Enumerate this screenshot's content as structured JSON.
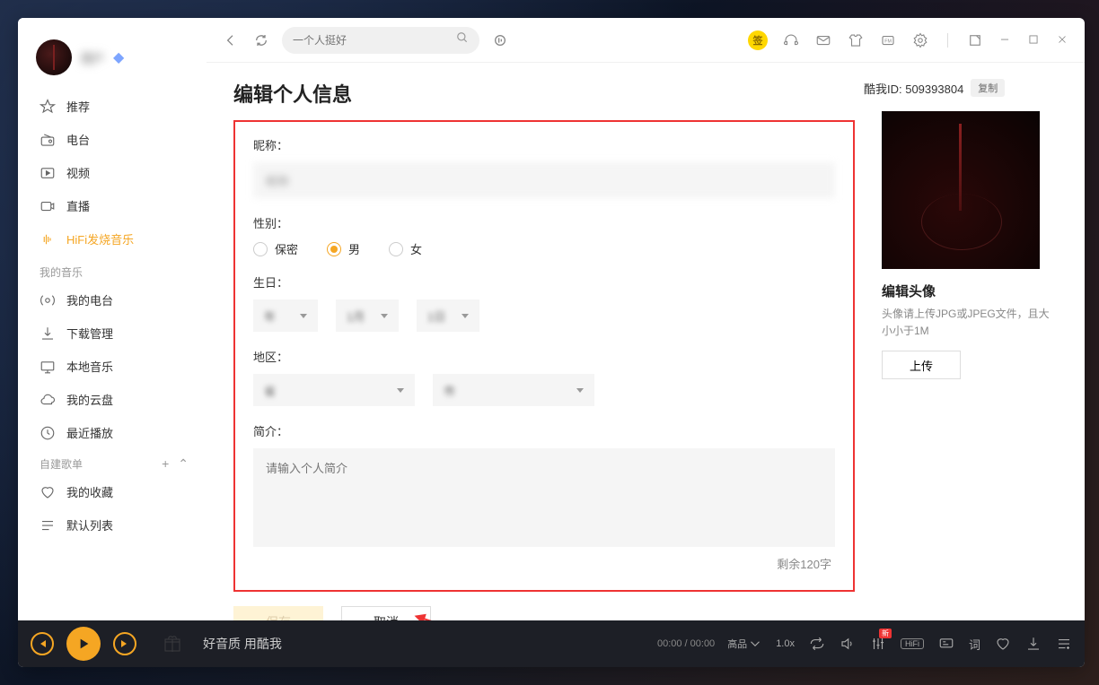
{
  "sidebar": {
    "username_blur": "用户",
    "items": [
      {
        "label": "推荐"
      },
      {
        "label": "电台"
      },
      {
        "label": "视频"
      },
      {
        "label": "直播"
      },
      {
        "label": "HiFi发烧音乐"
      }
    ],
    "section_my": "我的音乐",
    "my_items": [
      {
        "label": "我的电台"
      },
      {
        "label": "下载管理"
      },
      {
        "label": "本地音乐"
      },
      {
        "label": "我的云盘"
      },
      {
        "label": "最近播放"
      }
    ],
    "section_lists": "自建歌单",
    "list_items": [
      {
        "label": "我的收藏"
      },
      {
        "label": "默认列表"
      }
    ]
  },
  "topbar": {
    "search_placeholder": "一个人挺好",
    "sign_char": "签"
  },
  "page": {
    "title": "编辑个人信息",
    "nick_label": "昵称：",
    "nick_blur": "昵称",
    "gender_label": "性别：",
    "gender_opts": {
      "secret": "保密",
      "male": "男",
      "female": "女"
    },
    "birth_label": "生日：",
    "birth_year_blur": "年",
    "birth_month_blur": "1月",
    "birth_day_blur": "1日",
    "region_label": "地区：",
    "region1_blur": "省",
    "region2_blur": "市",
    "bio_label": "简介：",
    "bio_placeholder": "请输入个人简介",
    "char_count": "剩余120字",
    "save": "保存",
    "cancel": "取消"
  },
  "right": {
    "id_label": "酷我ID: 509393804",
    "copy": "复制",
    "edit_avatar_title": "编辑头像",
    "edit_avatar_hint": "头像请上传JPG或JPEG文件，且大小小于1M",
    "upload": "上传"
  },
  "player": {
    "slogan": "好音质 用酷我",
    "time": "00:00 / 00:00",
    "quality": "高品",
    "speed": "1.0x",
    "hifi": "HiFi",
    "new_badge": "新",
    "lyric": "词"
  }
}
